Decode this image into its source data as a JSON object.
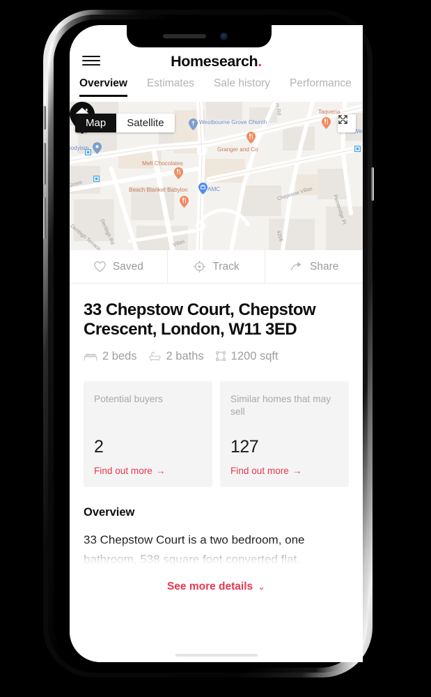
{
  "header": {
    "menu_icon": "hamburger-icon",
    "logo_text": "Homesearch",
    "logo_dot": ".",
    "accent_color": "#e8384f"
  },
  "tabs": [
    {
      "label": "Overview",
      "active": true
    },
    {
      "label": "Estimates",
      "active": false
    },
    {
      "label": "Sale history",
      "active": false
    },
    {
      "label": "Performance",
      "active": false
    }
  ],
  "map": {
    "toggle": [
      {
        "label": "Map",
        "active": true
      },
      {
        "label": "Satellite",
        "active": false
      }
    ],
    "expand_icon": "fullscreen-expand-icon",
    "pin_icon": "home-marker-pin",
    "pois": [
      {
        "label": "Westbourne Grove Church",
        "type": "church",
        "color": "#6b8fc9"
      },
      {
        "label": "Granger and Co",
        "type": "restaurant",
        "color": "#c9785a"
      },
      {
        "label": "Taqueria",
        "type": "restaurant",
        "color": "#c9785a"
      },
      {
        "label": "Melt Chocolates",
        "type": "restaurant",
        "color": "#c9785a"
      },
      {
        "label": "Beach Blanket Babylon",
        "type": "restaurant",
        "color": "#c9785a"
      },
      {
        "label": "Bodyism",
        "type": "place",
        "color": "#6b8fc9"
      },
      {
        "label": "AMC",
        "type": "shop",
        "color": "#6b8fc9"
      },
      {
        "label": "Wes",
        "type": "place",
        "color": "#6b8fc9"
      }
    ],
    "roads": [
      "Chepstow Villas",
      "Pembridge Pl",
      "Denbigh Rd",
      "Denbigh Terrace",
      "Villas",
      "Grove",
      "4206",
      "m Rd"
    ]
  },
  "action_bar": [
    {
      "label": "Saved",
      "icon": "heart-icon"
    },
    {
      "label": "Track",
      "icon": "crosshair-icon"
    },
    {
      "label": "Share",
      "icon": "share-arrow-icon"
    }
  ],
  "property": {
    "title": "33 Chepstow Court, Chepstow Crescent, London, W11 3ED",
    "specs": [
      {
        "icon": "bed-icon",
        "label": "2 beds"
      },
      {
        "icon": "bath-icon",
        "label": "2 baths"
      },
      {
        "icon": "area-icon",
        "label": "1200 sqft"
      }
    ]
  },
  "stat_cards": [
    {
      "label": "Potential buyers",
      "value": "2",
      "link": "Find out more",
      "link_arrow": "→"
    },
    {
      "label": "Similar homes that may sell",
      "value": "127",
      "link": "Find out more",
      "link_arrow": "→"
    }
  ],
  "overview": {
    "heading": "Overview",
    "body": "33 Chepstow Court is a two bedroom, one bathroom, 538 square foot converted flat.",
    "see_more": "See more details",
    "chevron": "⌄"
  }
}
